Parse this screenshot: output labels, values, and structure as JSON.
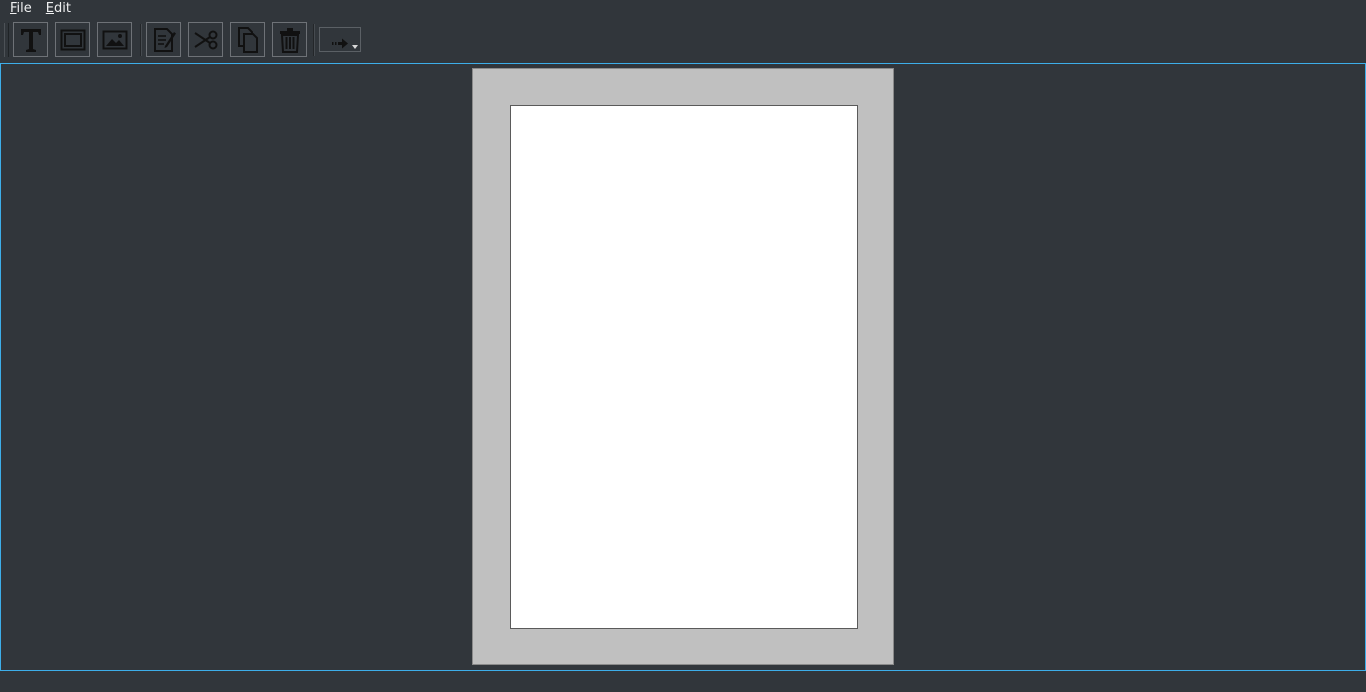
{
  "menubar": {
    "items": [
      {
        "mnemonic": "F",
        "rest": "ile"
      },
      {
        "mnemonic": "E",
        "rest": "dit"
      }
    ]
  },
  "toolbar": {
    "buttons": [
      {
        "icon": "text-icon"
      },
      {
        "icon": "frame-icon"
      },
      {
        "icon": "image-icon"
      },
      {
        "icon": "edit-note-icon"
      },
      {
        "icon": "scissors-icon"
      },
      {
        "icon": "copy-icon"
      },
      {
        "icon": "trash-icon"
      }
    ],
    "dropdown_icon": "arrow-right-icon"
  },
  "colors": {
    "background": "#31363b",
    "focus": "#3daee9",
    "paper": "#c0c0c0",
    "page": "#ffffff"
  }
}
